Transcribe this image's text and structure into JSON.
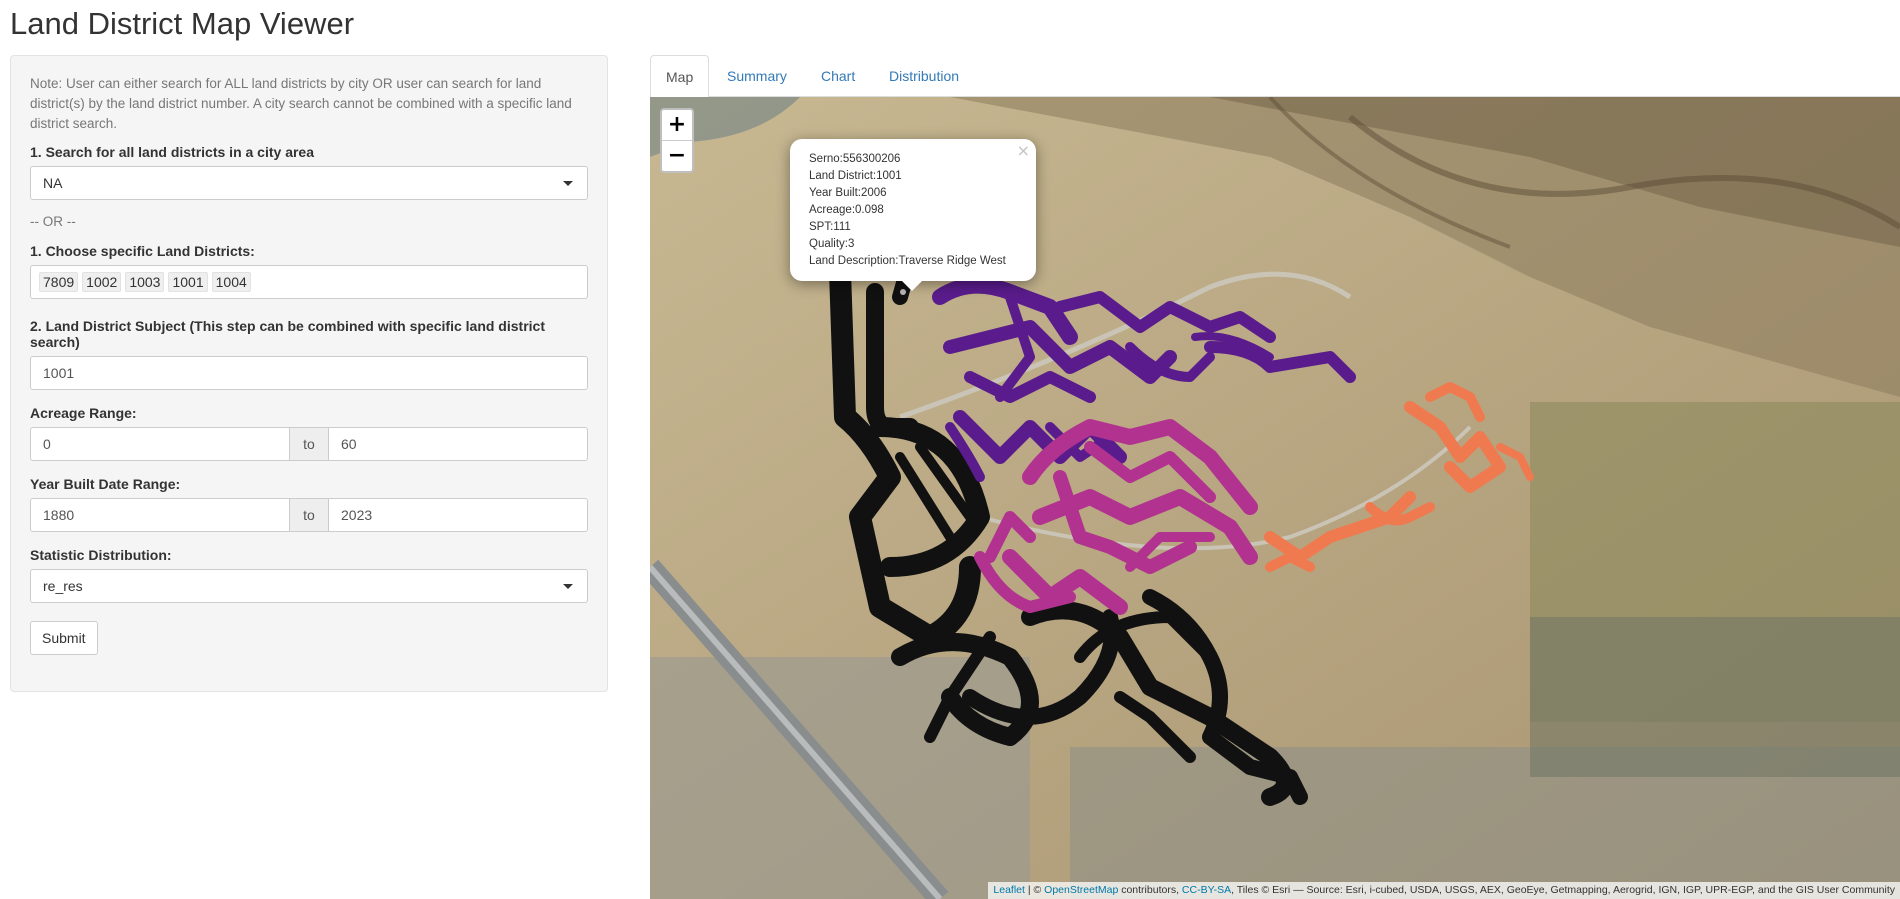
{
  "app": {
    "title": "Land District Map Viewer"
  },
  "sidebar": {
    "note": "Note: User can either search for ALL land districts by city OR user can search for land district(s) by the land district number. A city search cannot be combined with a specific land district search.",
    "city_label": "1. Search for all land districts in a city area",
    "city_value": "NA",
    "or_text": "-- OR --",
    "districts_label": "1. Choose specific Land Districts:",
    "districts": [
      "7809",
      "1002",
      "1003",
      "1001",
      "1004"
    ],
    "subject_label": "2. Land District Subject (This step can be combined with specific land district search)",
    "subject_value": "1001",
    "acreage_label": "Acreage Range:",
    "acreage_min": "0",
    "acreage_max": "60",
    "year_label": "Year Built Date Range:",
    "year_min": "1880",
    "year_max": "2023",
    "range_to": "to",
    "stat_label": "Statistic Distribution:",
    "stat_value": "re_res",
    "submit_label": "Submit"
  },
  "tabs": [
    {
      "label": "Map",
      "active": true
    },
    {
      "label": "Summary",
      "active": false
    },
    {
      "label": "Chart",
      "active": false
    },
    {
      "label": "Distribution",
      "active": false
    }
  ],
  "map": {
    "zoom_in": "+",
    "zoom_out": "−",
    "popup": {
      "close": "×",
      "lines": [
        "Serno:556300206",
        "Land District:1001",
        "Year Built:2006",
        "Acreage:0.098",
        "SPT:111",
        "Quality:3",
        "Land Description:Traverse Ridge West"
      ]
    },
    "attribution": {
      "leaflet": "Leaflet",
      "sep1": " | © ",
      "osm": "OpenStreetMap",
      "contributors": " contributors, ",
      "license": "CC-BY-SA",
      "tiles": ", Tiles © Esri — Source: Esri, i-cubed, USDA, USGS, AEX, GeoEye, Getmapping, Aerogrid, IGN, IGP, UPR-EGP, and the GIS User Community"
    },
    "colors": {
      "district_black": "#111111",
      "district_purple": "#5a1c8c",
      "district_magenta": "#b2338f",
      "district_orange": "#f07a4f"
    }
  }
}
